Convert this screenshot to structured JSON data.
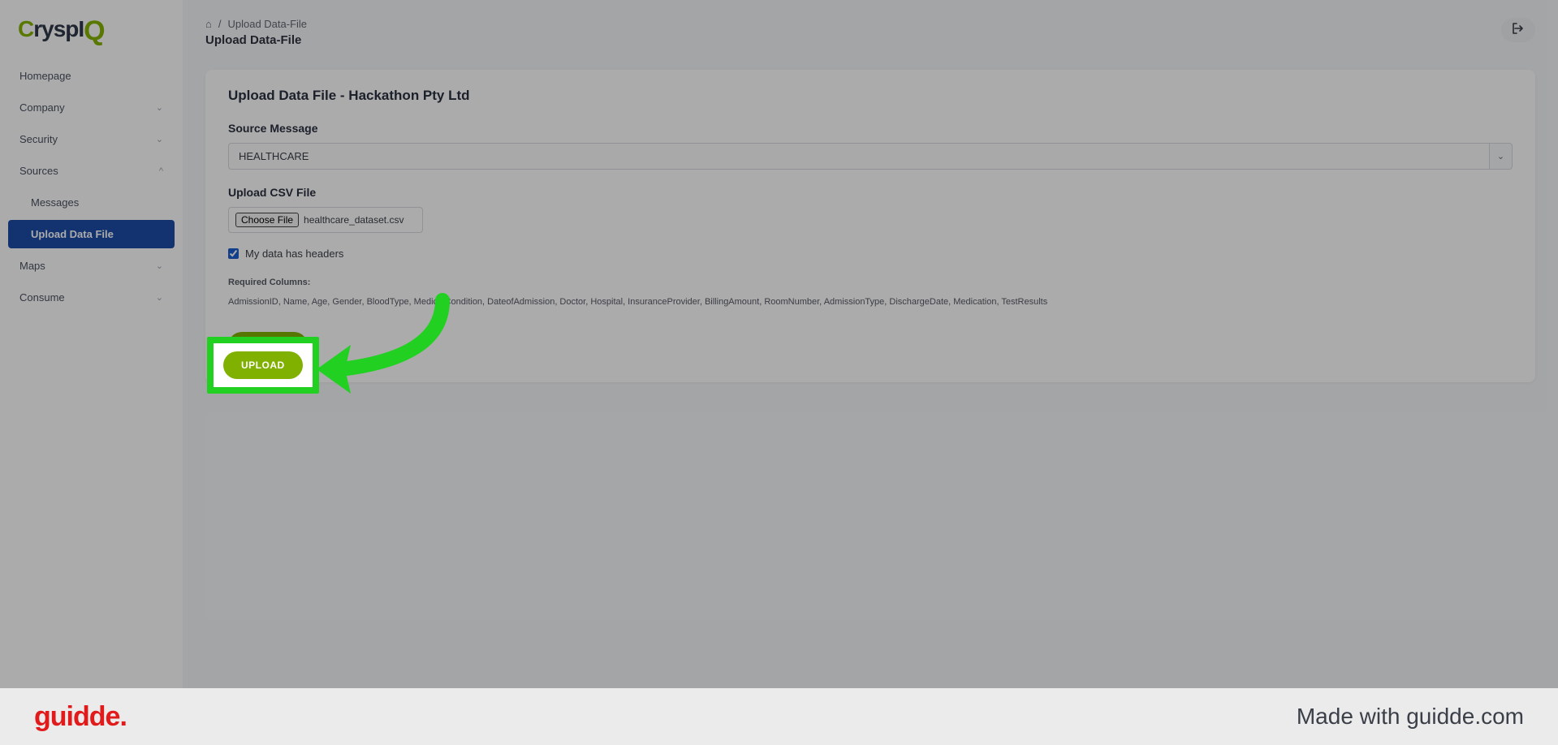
{
  "logo": {
    "text": "CryspIQ"
  },
  "sidebar": {
    "items": [
      {
        "label": "Homepage",
        "chev": ""
      },
      {
        "label": "Company",
        "chev": "⌄"
      },
      {
        "label": "Security",
        "chev": "⌄"
      },
      {
        "label": "Sources",
        "chev": "^"
      },
      {
        "label": "Maps",
        "chev": "⌄"
      },
      {
        "label": "Consume",
        "chev": "⌄"
      }
    ],
    "sources_children": [
      {
        "label": "Messages"
      },
      {
        "label": "Upload Data File"
      }
    ]
  },
  "breadcrumb": {
    "sep": "/",
    "item": "Upload Data-File"
  },
  "page_title": "Upload Data-File",
  "card": {
    "title": "Upload Data File - Hackathon Pty Ltd",
    "source_label": "Source Message",
    "source_value": "HEALTHCARE",
    "upload_label": "Upload CSV File",
    "choose_file_label": "Choose File",
    "file_name": "healthcare_dataset.csv",
    "headers_checkbox_label": "My data has headers",
    "headers_checked": true,
    "required_label": "Required Columns:",
    "required_columns": "AdmissionID, Name, Age, Gender, BloodType, MedicalCondition, DateofAdmission, Doctor, Hospital, InsuranceProvider, BillingAmount, RoomNumber, AdmissionType, DischargeDate, Medication, TestResults",
    "upload_button": "UPLOAD"
  },
  "highlight": {
    "upload_button": "UPLOAD"
  },
  "footer": {
    "logo": "guidde",
    "dot": ".",
    "text": "Made with guidde.com"
  }
}
